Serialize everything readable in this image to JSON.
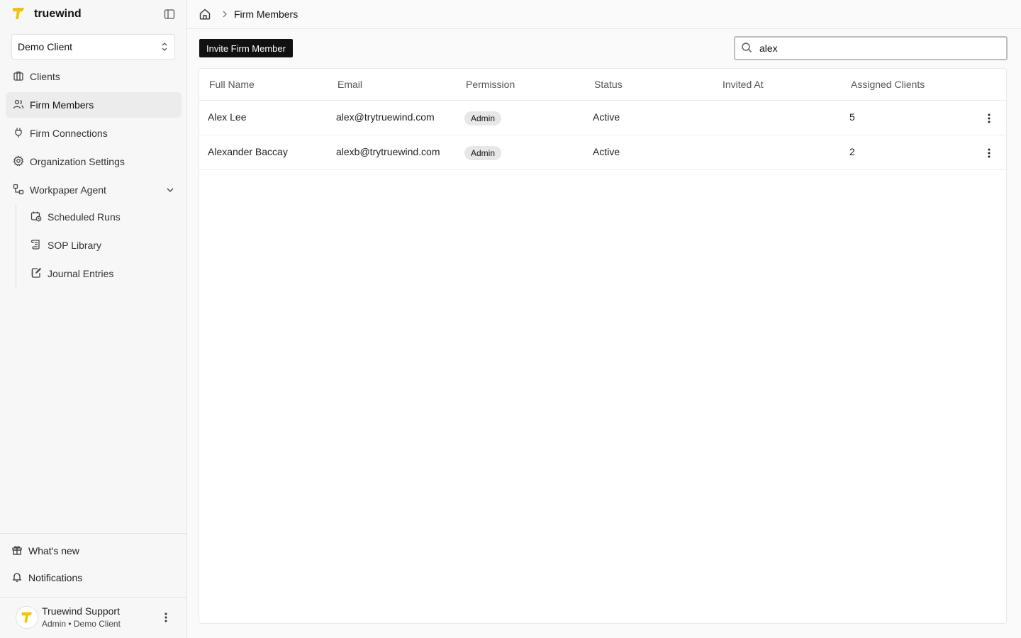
{
  "brand": {
    "name": "truewind",
    "accent": "#f5c400"
  },
  "client_selector": {
    "value": "Demo Client"
  },
  "nav": {
    "items": [
      {
        "label": "Clients",
        "icon": "building-icon"
      },
      {
        "label": "Firm Members",
        "icon": "users-icon",
        "active": true
      },
      {
        "label": "Firm Connections",
        "icon": "plug-icon"
      },
      {
        "label": "Organization Settings",
        "icon": "gear-icon"
      },
      {
        "label": "Workpaper Agent",
        "icon": "workflow-icon",
        "expanded": true
      }
    ],
    "sub_items": [
      {
        "label": "Scheduled Runs",
        "icon": "calendar-clock-icon"
      },
      {
        "label": "SOP Library",
        "icon": "scroll-icon"
      },
      {
        "label": "Journal Entries",
        "icon": "notebook-pen-icon"
      }
    ]
  },
  "bottom": {
    "whats_new": "What's new",
    "notifications": "Notifications"
  },
  "user": {
    "name": "Truewind Support",
    "role": "Admin • Demo Client"
  },
  "breadcrumb": {
    "current": "Firm Members"
  },
  "toolbar": {
    "invite_label": "Invite Firm Member"
  },
  "search": {
    "value": "alex",
    "placeholder": "Search"
  },
  "table": {
    "columns": [
      "Full Name",
      "Email",
      "Permission",
      "Status",
      "Invited At",
      "Assigned Clients"
    ],
    "rows": [
      {
        "name": "Alex Lee",
        "email": "alex@trytruewind.com",
        "permission": "Admin",
        "status": "Active",
        "invited_at": "",
        "assigned_clients": "5"
      },
      {
        "name": "Alexander Baccay",
        "email": "alexb@trytruewind.com",
        "permission": "Admin",
        "status": "Active",
        "invited_at": "",
        "assigned_clients": "2"
      }
    ]
  }
}
